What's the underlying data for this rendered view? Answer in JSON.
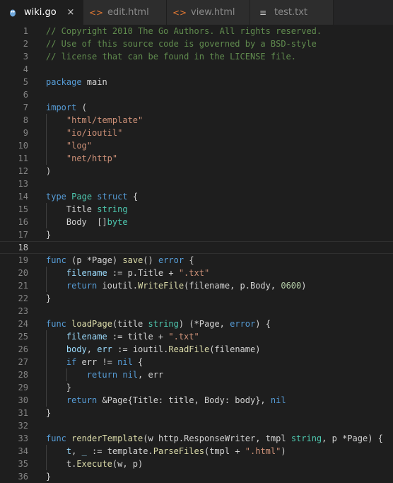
{
  "tabs": [
    {
      "label": "wiki.go",
      "icon": "go-file-icon",
      "active": true,
      "close": "×"
    },
    {
      "label": "edit.html",
      "icon": "html-file-icon",
      "active": false,
      "close": ""
    },
    {
      "label": "view.html",
      "icon": "html-file-icon",
      "active": false,
      "close": ""
    },
    {
      "label": "test.txt",
      "icon": "text-file-icon",
      "active": false,
      "close": ""
    }
  ],
  "colors": {
    "comment": "#608b4e",
    "keyword": "#569cd6",
    "type": "#4ec9b0",
    "string": "#ce9178",
    "function": "#dcdcaa",
    "number": "#b5cea8",
    "variable": "#9cdcfe",
    "plain": "#d4d4d4"
  },
  "current_line": 18,
  "lines": [
    {
      "n": "1",
      "indent": 0,
      "tokens": [
        {
          "c": "comment",
          "t": "// Copyright 2010 The Go Authors. All rights reserved."
        }
      ]
    },
    {
      "n": "2",
      "indent": 0,
      "tokens": [
        {
          "c": "comment",
          "t": "// Use of this source code is governed by a BSD-style"
        }
      ]
    },
    {
      "n": "3",
      "indent": 0,
      "tokens": [
        {
          "c": "comment",
          "t": "// license that can be found in the LICENSE file."
        }
      ]
    },
    {
      "n": "4",
      "indent": 0,
      "tokens": []
    },
    {
      "n": "5",
      "indent": 0,
      "tokens": [
        {
          "c": "keyword",
          "t": "package"
        },
        {
          "c": "plain",
          "t": " main"
        }
      ]
    },
    {
      "n": "6",
      "indent": 0,
      "tokens": []
    },
    {
      "n": "7",
      "indent": 0,
      "tokens": [
        {
          "c": "keyword",
          "t": "import"
        },
        {
          "c": "plain",
          "t": " ("
        }
      ]
    },
    {
      "n": "8",
      "indent": 1,
      "tokens": [
        {
          "c": "string",
          "t": "\"html/template\""
        }
      ]
    },
    {
      "n": "9",
      "indent": 1,
      "tokens": [
        {
          "c": "string",
          "t": "\"io/ioutil\""
        }
      ]
    },
    {
      "n": "10",
      "indent": 1,
      "tokens": [
        {
          "c": "string",
          "t": "\"log\""
        }
      ]
    },
    {
      "n": "11",
      "indent": 1,
      "tokens": [
        {
          "c": "string",
          "t": "\"net/http\""
        }
      ]
    },
    {
      "n": "12",
      "indent": 0,
      "tokens": [
        {
          "c": "plain",
          "t": ")"
        }
      ]
    },
    {
      "n": "13",
      "indent": 0,
      "tokens": []
    },
    {
      "n": "14",
      "indent": 0,
      "tokens": [
        {
          "c": "keyword",
          "t": "type"
        },
        {
          "c": "plain",
          "t": " "
        },
        {
          "c": "type",
          "t": "Page"
        },
        {
          "c": "plain",
          "t": " "
        },
        {
          "c": "keyword",
          "t": "struct"
        },
        {
          "c": "plain",
          "t": " {"
        }
      ]
    },
    {
      "n": "15",
      "indent": 1,
      "tokens": [
        {
          "c": "plain",
          "t": "Title "
        },
        {
          "c": "type",
          "t": "string"
        }
      ]
    },
    {
      "n": "16",
      "indent": 1,
      "tokens": [
        {
          "c": "plain",
          "t": "Body  []"
        },
        {
          "c": "type",
          "t": "byte"
        }
      ]
    },
    {
      "n": "17",
      "indent": 0,
      "tokens": [
        {
          "c": "plain",
          "t": "}"
        }
      ]
    },
    {
      "n": "18",
      "indent": 0,
      "tokens": []
    },
    {
      "n": "19",
      "indent": 0,
      "tokens": [
        {
          "c": "keyword",
          "t": "func"
        },
        {
          "c": "plain",
          "t": " (p *Page) "
        },
        {
          "c": "function",
          "t": "save"
        },
        {
          "c": "plain",
          "t": "() "
        },
        {
          "c": "keyword",
          "t": "error"
        },
        {
          "c": "plain",
          "t": " {"
        }
      ]
    },
    {
      "n": "20",
      "indent": 1,
      "tokens": [
        {
          "c": "variable",
          "t": "filename"
        },
        {
          "c": "plain",
          "t": " := p.Title + "
        },
        {
          "c": "string",
          "t": "\".txt\""
        }
      ]
    },
    {
      "n": "21",
      "indent": 1,
      "tokens": [
        {
          "c": "keyword",
          "t": "return"
        },
        {
          "c": "plain",
          "t": " ioutil."
        },
        {
          "c": "function",
          "t": "WriteFile"
        },
        {
          "c": "plain",
          "t": "(filename, p.Body, "
        },
        {
          "c": "number",
          "t": "0600"
        },
        {
          "c": "plain",
          "t": ")"
        }
      ]
    },
    {
      "n": "22",
      "indent": 0,
      "tokens": [
        {
          "c": "plain",
          "t": "}"
        }
      ]
    },
    {
      "n": "23",
      "indent": 0,
      "tokens": []
    },
    {
      "n": "24",
      "indent": 0,
      "tokens": [
        {
          "c": "keyword",
          "t": "func"
        },
        {
          "c": "plain",
          "t": " "
        },
        {
          "c": "function",
          "t": "loadPage"
        },
        {
          "c": "plain",
          "t": "(title "
        },
        {
          "c": "type",
          "t": "string"
        },
        {
          "c": "plain",
          "t": ") (*Page, "
        },
        {
          "c": "keyword",
          "t": "error"
        },
        {
          "c": "plain",
          "t": ") {"
        }
      ]
    },
    {
      "n": "25",
      "indent": 1,
      "tokens": [
        {
          "c": "variable",
          "t": "filename"
        },
        {
          "c": "plain",
          "t": " := title + "
        },
        {
          "c": "string",
          "t": "\".txt\""
        }
      ]
    },
    {
      "n": "26",
      "indent": 1,
      "tokens": [
        {
          "c": "variable",
          "t": "body"
        },
        {
          "c": "plain",
          "t": ", "
        },
        {
          "c": "variable",
          "t": "err"
        },
        {
          "c": "plain",
          "t": " := ioutil."
        },
        {
          "c": "function",
          "t": "ReadFile"
        },
        {
          "c": "plain",
          "t": "(filename)"
        }
      ]
    },
    {
      "n": "27",
      "indent": 1,
      "tokens": [
        {
          "c": "keyword",
          "t": "if"
        },
        {
          "c": "plain",
          "t": " err != "
        },
        {
          "c": "keyword",
          "t": "nil"
        },
        {
          "c": "plain",
          "t": " {"
        }
      ]
    },
    {
      "n": "28",
      "indent": 2,
      "tokens": [
        {
          "c": "keyword",
          "t": "return"
        },
        {
          "c": "plain",
          "t": " "
        },
        {
          "c": "keyword",
          "t": "nil"
        },
        {
          "c": "plain",
          "t": ", err"
        }
      ]
    },
    {
      "n": "29",
      "indent": 1,
      "tokens": [
        {
          "c": "plain",
          "t": "}"
        }
      ]
    },
    {
      "n": "30",
      "indent": 1,
      "tokens": [
        {
          "c": "keyword",
          "t": "return"
        },
        {
          "c": "plain",
          "t": " &Page{Title: title, Body: body}, "
        },
        {
          "c": "keyword",
          "t": "nil"
        }
      ]
    },
    {
      "n": "31",
      "indent": 0,
      "tokens": [
        {
          "c": "plain",
          "t": "}"
        }
      ]
    },
    {
      "n": "32",
      "indent": 0,
      "tokens": []
    },
    {
      "n": "33",
      "indent": 0,
      "tokens": [
        {
          "c": "keyword",
          "t": "func"
        },
        {
          "c": "plain",
          "t": " "
        },
        {
          "c": "function",
          "t": "renderTemplate"
        },
        {
          "c": "plain",
          "t": "(w http.ResponseWriter, tmpl "
        },
        {
          "c": "type",
          "t": "string"
        },
        {
          "c": "plain",
          "t": ", p *Page) {"
        }
      ]
    },
    {
      "n": "34",
      "indent": 1,
      "tokens": [
        {
          "c": "variable",
          "t": "t"
        },
        {
          "c": "plain",
          "t": ", "
        },
        {
          "c": "variable",
          "t": "_"
        },
        {
          "c": "plain",
          "t": " := template."
        },
        {
          "c": "function",
          "t": "ParseFiles"
        },
        {
          "c": "plain",
          "t": "(tmpl + "
        },
        {
          "c": "string",
          "t": "\".html\""
        },
        {
          "c": "plain",
          "t": ")"
        }
      ]
    },
    {
      "n": "35",
      "indent": 1,
      "tokens": [
        {
          "c": "plain",
          "t": "t."
        },
        {
          "c": "function",
          "t": "Execute"
        },
        {
          "c": "plain",
          "t": "(w, p)"
        }
      ]
    },
    {
      "n": "36",
      "indent": 0,
      "tokens": [
        {
          "c": "plain",
          "t": "}"
        }
      ]
    }
  ]
}
